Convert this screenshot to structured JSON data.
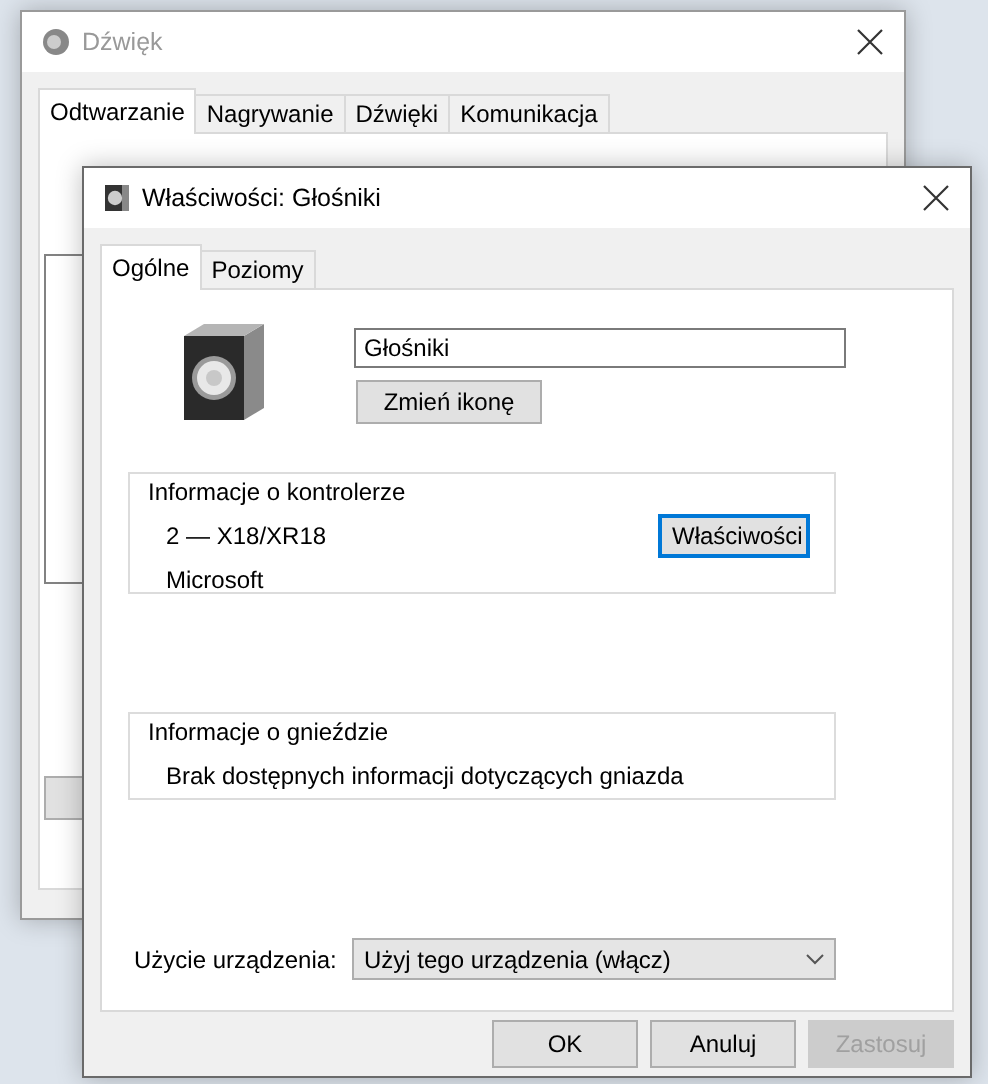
{
  "background_window": {
    "title": "Dźwięk",
    "active": false,
    "tabs": [
      {
        "label": "Odtwarzanie",
        "selected": true
      },
      {
        "label": "Nagrywanie",
        "selected": false
      },
      {
        "label": "Dźwięki",
        "selected": false
      },
      {
        "label": "Komunikacja",
        "selected": false
      }
    ]
  },
  "dialog": {
    "title": "Właściwości: Głośniki",
    "active": true,
    "tabs": [
      {
        "label": "Ogólne",
        "selected": true
      },
      {
        "label": "Poziomy",
        "selected": false
      }
    ],
    "device_name": "Głośniki",
    "change_icon_button": "Zmień ikonę",
    "controller_info": {
      "title": "Informacje o kontrolerze",
      "lines": [
        "2 — X18/XR18",
        "Microsoft"
      ],
      "button": "Właściwości"
    },
    "jack_info": {
      "title": "Informacje o gnieździe",
      "text": "Brak dostępnych informacji dotyczących gniazda"
    },
    "device_usage": {
      "label": "Użycie urządzenia:",
      "value": "Użyj tego urządzenia (włącz)"
    },
    "buttons": [
      {
        "label": "OK",
        "disabled": false
      },
      {
        "label": "Anuluj",
        "disabled": false
      },
      {
        "label": "Zastosuj",
        "disabled": true
      }
    ]
  }
}
